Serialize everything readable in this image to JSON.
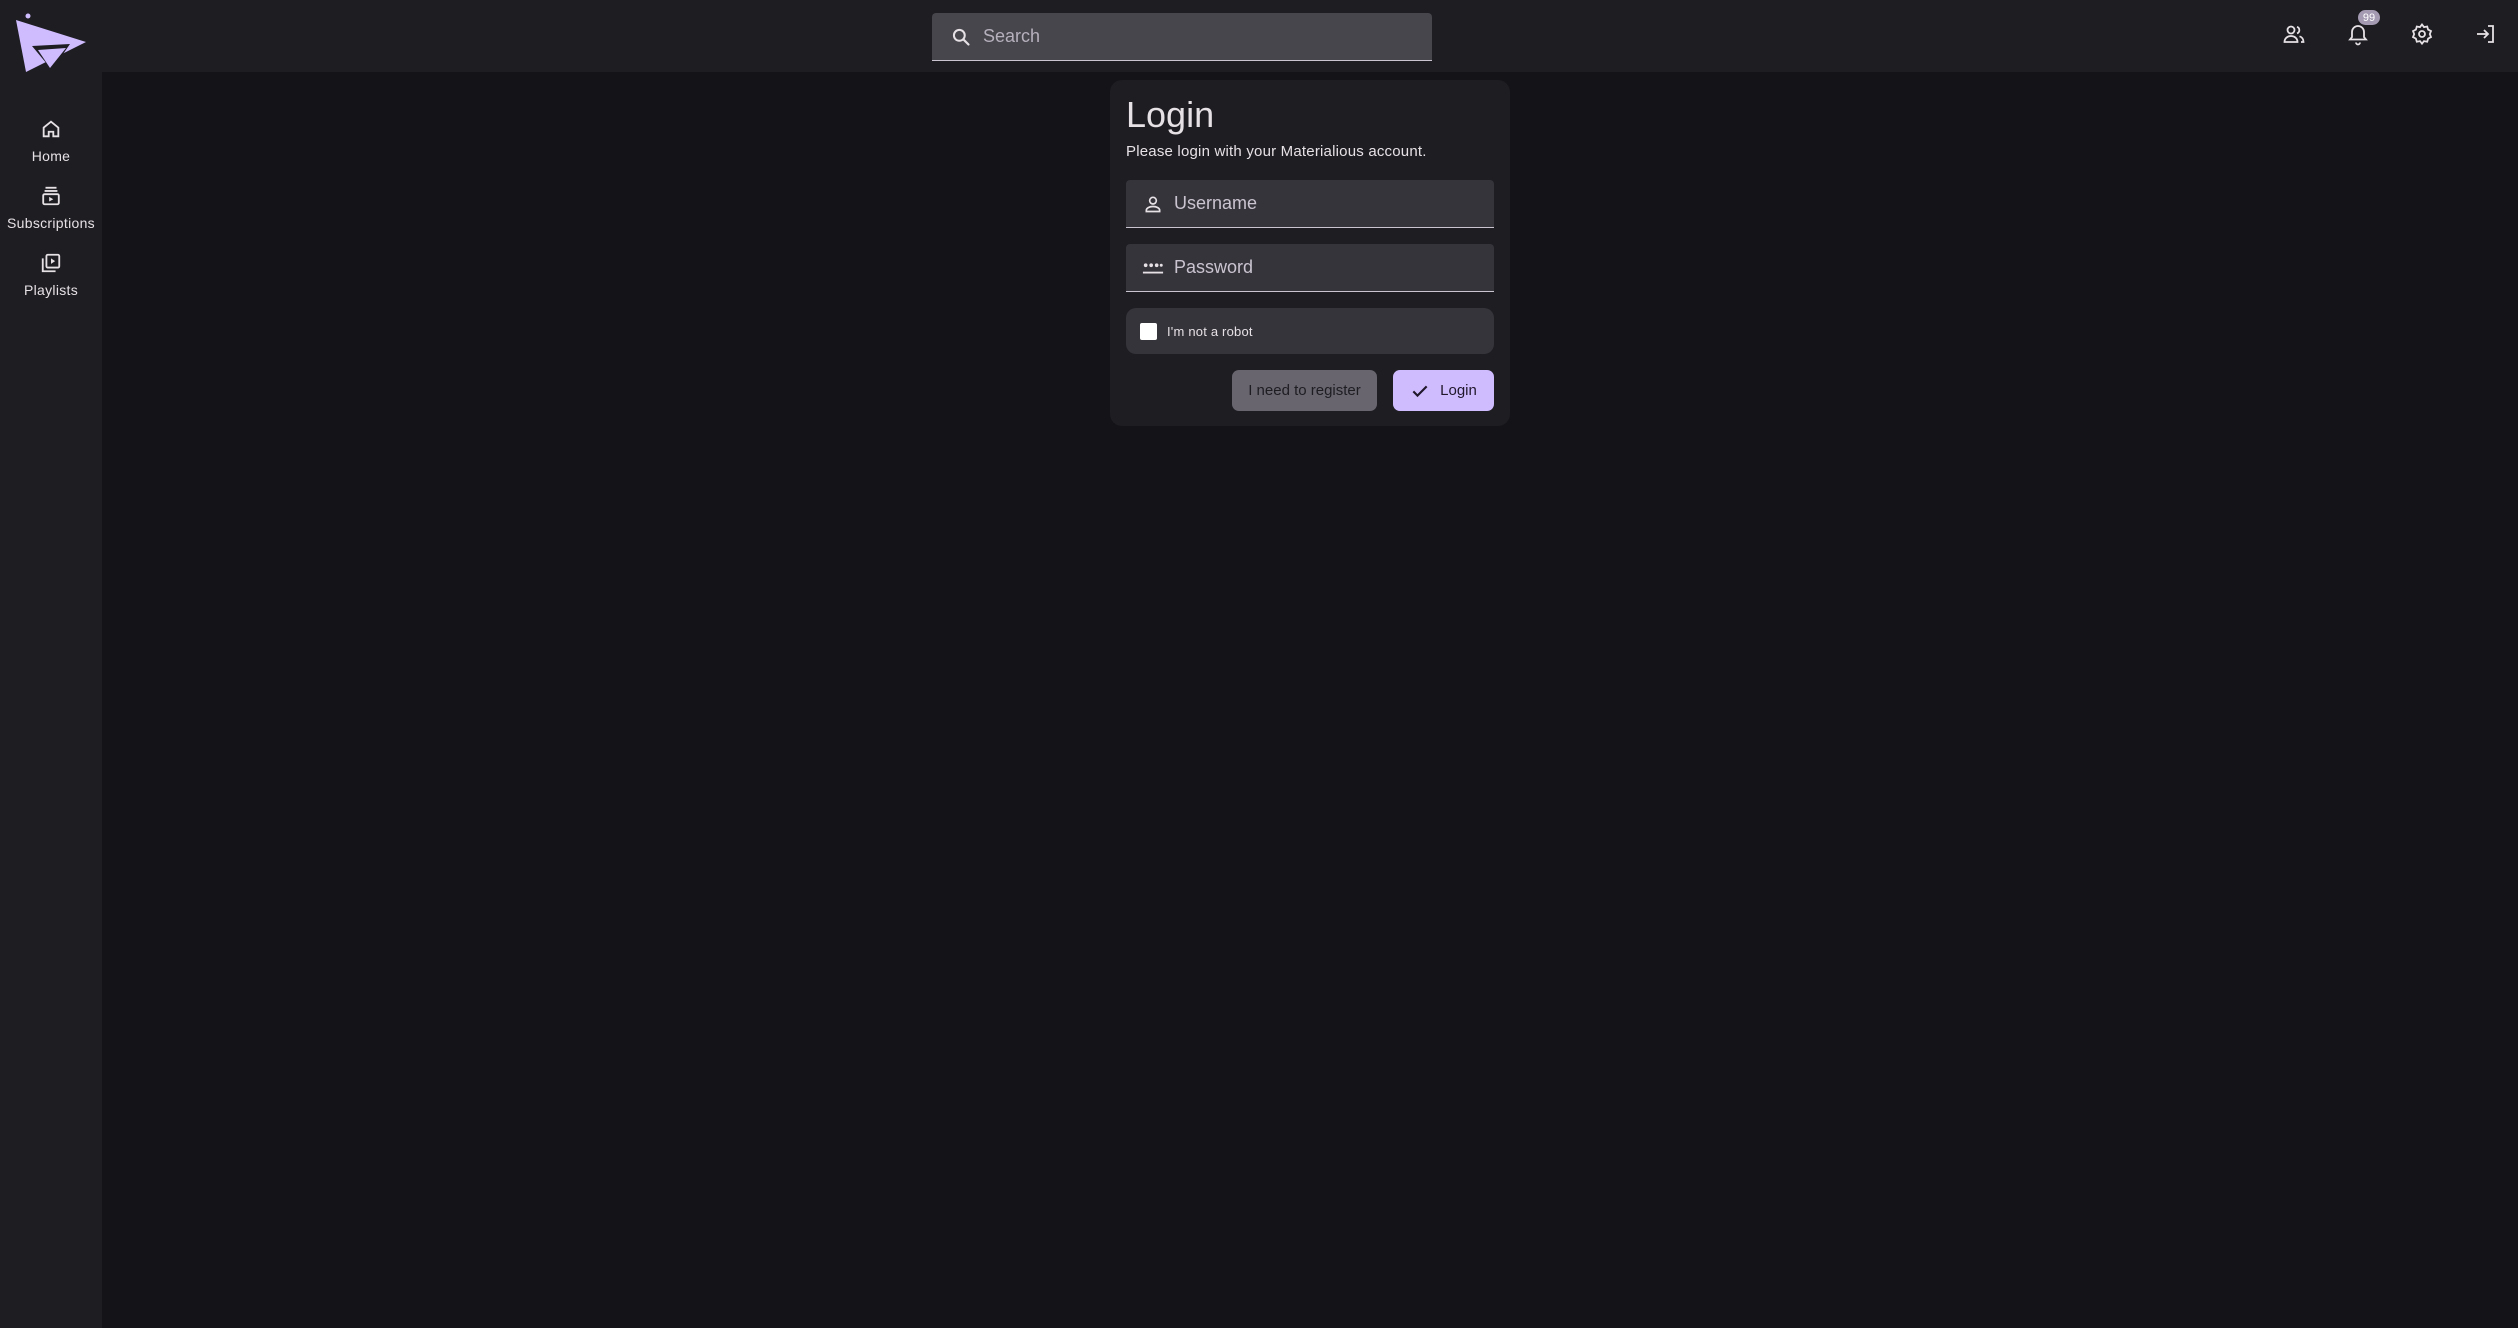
{
  "app": {
    "brand_color": "#cfbcff"
  },
  "header": {
    "search": {
      "placeholder": "Search"
    },
    "icons": [
      {
        "name": "friends-icon"
      },
      {
        "name": "notifications-icon",
        "badge": "99"
      },
      {
        "name": "settings-icon"
      },
      {
        "name": "login-icon"
      }
    ]
  },
  "sidebar": {
    "items": [
      {
        "label": "Home",
        "icon": "home-icon"
      },
      {
        "label": "Subscriptions",
        "icon": "subscriptions-icon"
      },
      {
        "label": "Playlists",
        "icon": "playlists-icon"
      }
    ]
  },
  "login": {
    "title": "Login",
    "subtitle": "Please login with your Materialious account.",
    "username": {
      "placeholder": "Username",
      "value": ""
    },
    "password": {
      "placeholder": "Password",
      "value": ""
    },
    "captcha_label": "I'm not a robot",
    "register_label": "I need to register",
    "login_label": "Login"
  }
}
